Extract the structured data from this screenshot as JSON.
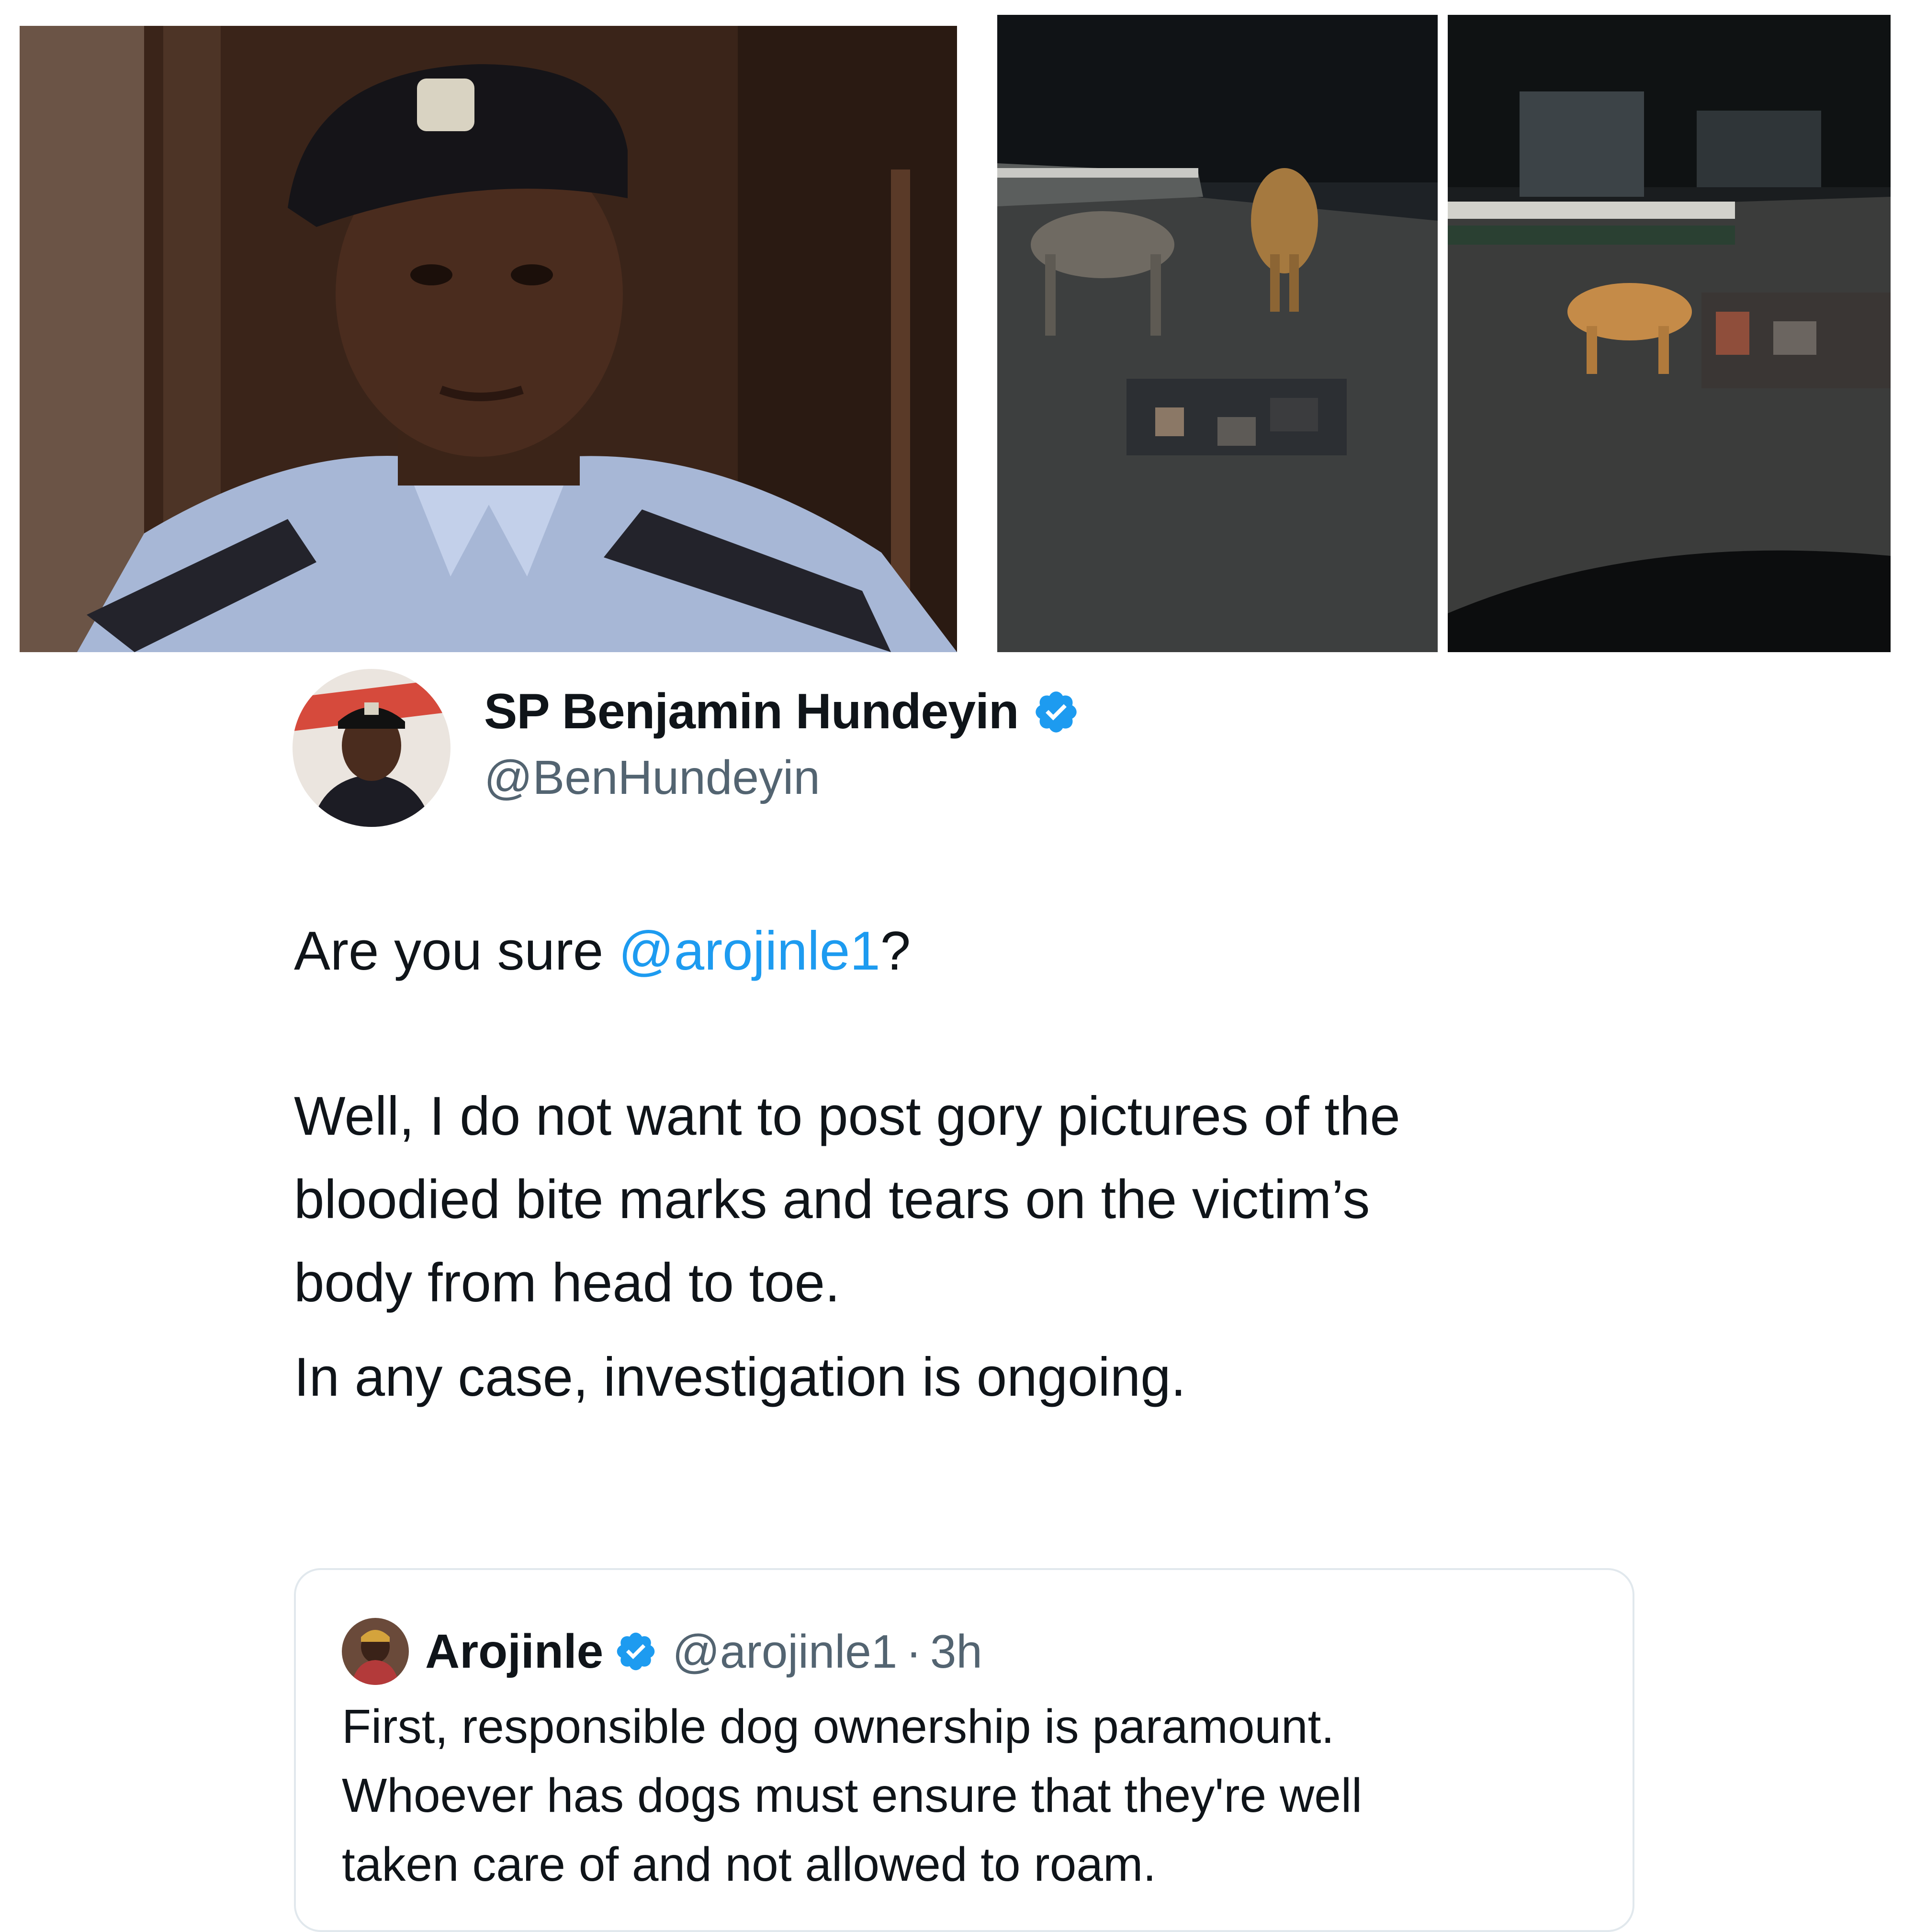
{
  "tweet": {
    "author_name": "SP Benjamin Hundeyin",
    "author_handle": "@BenHundeyin",
    "body": {
      "p1_prefix": "Are you sure ",
      "p1_mention": "@arojinle1",
      "p1_suffix": "?",
      "p2": "Well, I do not want to post gory pictures of the\nbloodied bite marks and tears on the victim’s\nbody from head to toe.",
      "p3": "In any case, investigation is ongoing."
    }
  },
  "quoted_tweet": {
    "author_name": "Arojinle",
    "author_handle": "@arojinle1",
    "separator": "·",
    "time": "3h",
    "text": "First, responsible dog ownership is paramount.\nWhoever has dogs must ensure that they're well\ntaken care of and not allowed to roam."
  },
  "colors": {
    "link": "#1d9bf0",
    "verified_badge": "#1d9bf0",
    "secondary_text": "#536471",
    "primary_text": "#0f1419",
    "card_border": "#e1e8ed"
  },
  "icons": {
    "verified": "verified-badge-icon"
  }
}
